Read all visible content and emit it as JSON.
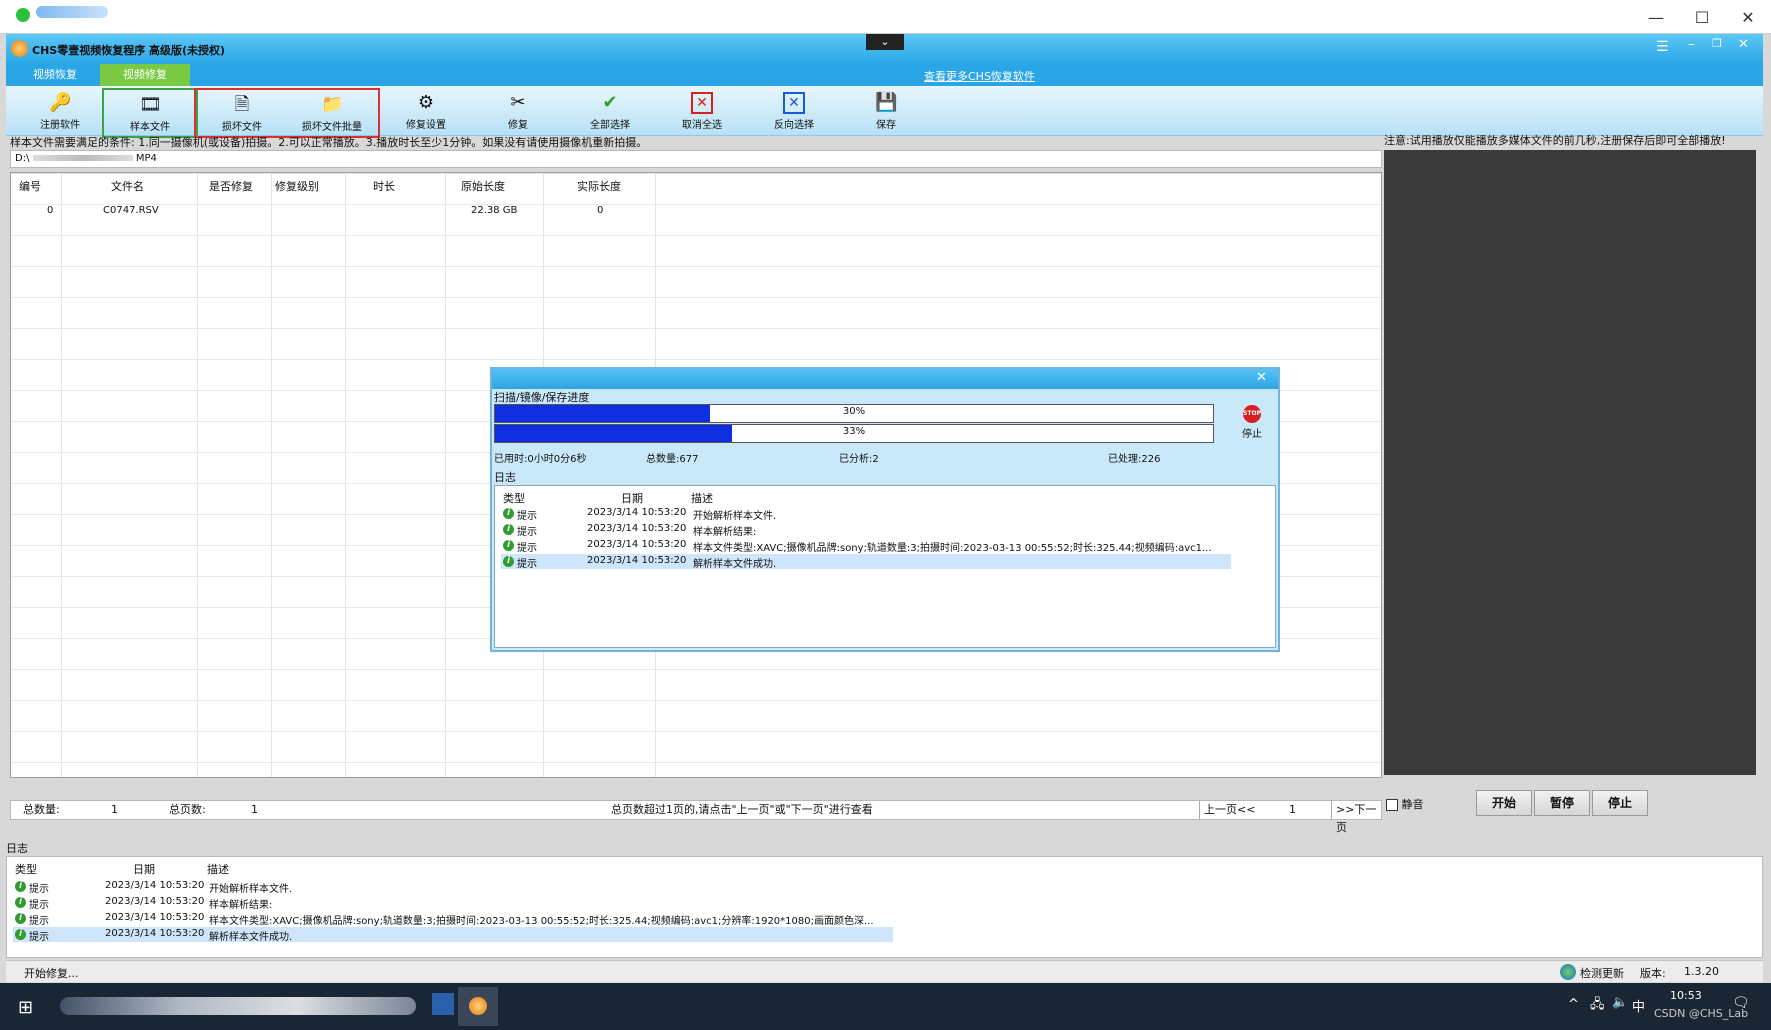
{
  "outer_window": {
    "tab_dots": ""
  },
  "app": {
    "title": "CHS零壹视频恢复程序 高级版(未授权)",
    "tabs": [
      "视频恢复",
      "视频修复"
    ],
    "more_link": "查看更多CHS恢复软件"
  },
  "toolbar": {
    "buttons": [
      {
        "label": "注册软件",
        "icon": "key-icon"
      },
      {
        "label": "样本文件",
        "icon": "film-icon"
      },
      {
        "label": "损坏文件",
        "icon": "file-icon"
      },
      {
        "label": "损坏文件批量",
        "icon": "folder-icon"
      },
      {
        "label": "修复设置",
        "icon": "settings-icon"
      },
      {
        "label": "修复",
        "icon": "tools-icon"
      },
      {
        "label": "全部选择",
        "icon": "check-icon"
      },
      {
        "label": "取消全选",
        "icon": "uncheck-icon"
      },
      {
        "label": "反向选择",
        "icon": "invert-icon"
      },
      {
        "label": "保存",
        "icon": "save-icon"
      }
    ]
  },
  "notice": "样本文件需要满足的条件: 1.同一摄像机(或设备)拍摄。2.可以正常播放。3.播放时长至少1分钟。如果没有请使用摄像机重新拍摄。",
  "path": {
    "prefix": "D:\\",
    "suffix": "MP4"
  },
  "grid": {
    "columns": [
      "编号",
      "文件名",
      "是否修复",
      "修复级别",
      "时长",
      "原始长度",
      "实际长度"
    ],
    "rows": [
      {
        "index": "0",
        "name": "C0747.RSV",
        "repaired": "",
        "level": "",
        "duration": "",
        "orig": "22.38 GB",
        "actual": "0"
      }
    ]
  },
  "preview": {
    "note": "注意:试用播放仅能播放多媒体文件的前几秒,注册保存后即可全部播放!"
  },
  "pager": {
    "total_label": "总数量:",
    "total": "1",
    "pages_label": "总页数:",
    "pages": "1",
    "hint": "总页数超过1页的,请点击\"上一页\"或\"下一页\"进行查看",
    "prev": "上一页<<",
    "page": "1",
    "next": ">>下一页"
  },
  "controls": {
    "mute": "静音",
    "start": "开始",
    "pause": "暂停",
    "stop": "停止"
  },
  "log": {
    "title": "日志",
    "columns": [
      "类型",
      "日期",
      "描述"
    ],
    "rows": [
      {
        "type": "提示",
        "date": "2023/3/14 10:53:20",
        "desc": "开始解析样本文件."
      },
      {
        "type": "提示",
        "date": "2023/3/14 10:53:20",
        "desc": "样本解析结果:"
      },
      {
        "type": "提示",
        "date": "2023/3/14 10:53:20",
        "desc": "样本文件类型:XAVC;摄像机品牌:sony;轨道数量:3;拍摄时间:2023-03-13 00:55:52;时长:325.44;视频编码:avc1;分辨率:1920*1080;画面颜色深..."
      },
      {
        "type": "提示",
        "date": "2023/3/14 10:53:20",
        "desc": "解析样本文件成功."
      }
    ]
  },
  "dialog": {
    "title": "扫描/镜像/保存进度",
    "progress1": 0.3,
    "progress1_text": "30%",
    "progress2": 0.33,
    "progress2_text": "33%",
    "stop": "停止",
    "elapsed": "已用时:0小时0分6秒",
    "total": "总数量:677",
    "analyzed": "已分析:2",
    "processed": "已处理:226",
    "log_title": "日志",
    "log_columns": [
      "类型",
      "日期",
      "描述"
    ],
    "log_rows": [
      {
        "type": "提示",
        "date": "2023/3/14 10:53:20",
        "desc": "开始解析样本文件."
      },
      {
        "type": "提示",
        "date": "2023/3/14 10:53:20",
        "desc": "样本解析结果:"
      },
      {
        "type": "提示",
        "date": "2023/3/14 10:53:20",
        "desc": "样本文件类型:XAVC;摄像机品牌:sony;轨道数量:3;拍摄时间:2023-03-13 00:55:52;时长:325.44;视频编码:avc1..."
      },
      {
        "type": "提示",
        "date": "2023/3/14 10:53:20",
        "desc": "解析样本文件成功."
      }
    ]
  },
  "status": {
    "left": "开始修复...",
    "update": "检测更新",
    "version_label": "版本:",
    "version": "1.3.20"
  },
  "taskbar": {
    "time": "10:53",
    "ime": "中",
    "watermark": "CSDN @CHS_Lab"
  },
  "colors": {
    "accent": "#2aa6e6",
    "progress": "#0f2fe0",
    "tab_active": "#7ac943"
  }
}
